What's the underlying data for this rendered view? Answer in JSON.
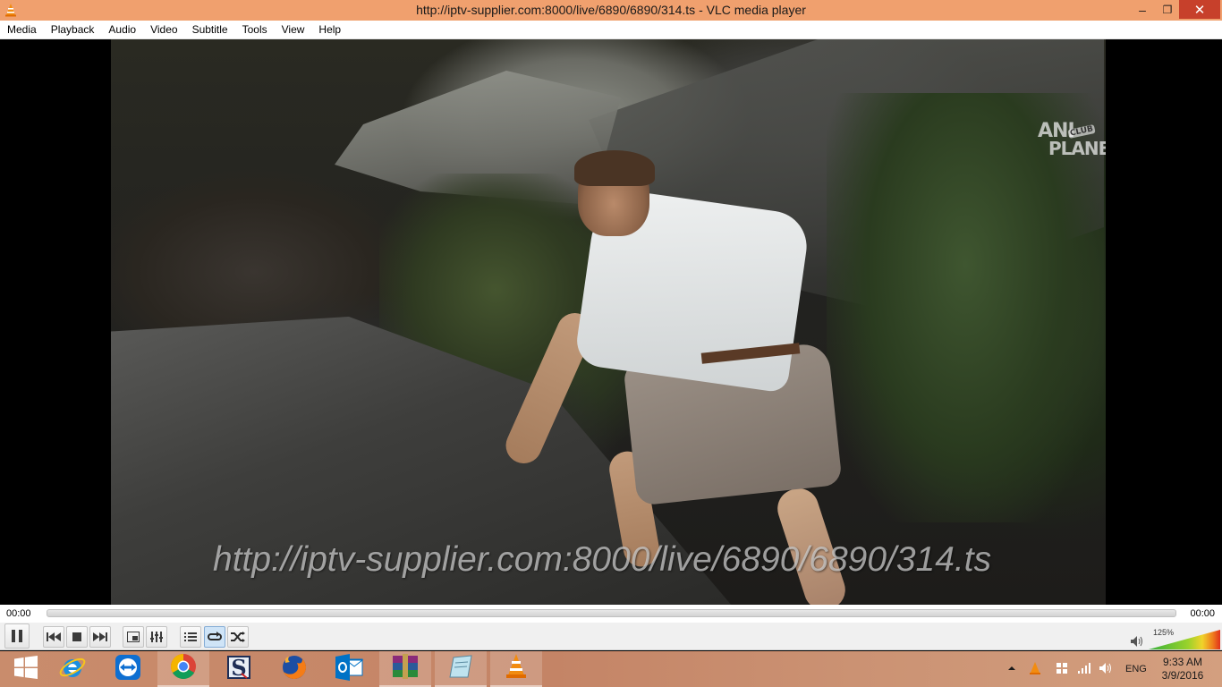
{
  "window": {
    "title": "http://iptv-supplier.com:8000/live/6890/6890/314.ts - VLC media player",
    "minimize": "–",
    "maximize": "❐",
    "close": "✕"
  },
  "menu": {
    "items": [
      "Media",
      "Playback",
      "Audio",
      "Video",
      "Subtitle",
      "Tools",
      "View",
      "Help"
    ]
  },
  "video": {
    "channel_logo_line1": "ANI",
    "channel_logo_club": "CLUB",
    "channel_logo_line2": "PLANET",
    "overlay_text": "http://iptv-supplier.com:8000/live/6890/6890/314.ts"
  },
  "seek": {
    "elapsed": "00:00",
    "total": "00:00",
    "position": 0
  },
  "controls": {
    "buttons": [
      {
        "name": "pause-button",
        "icon": "pause-icon"
      },
      {
        "name": "previous-button",
        "icon": "skip-previous-icon"
      },
      {
        "name": "stop-button",
        "icon": "stop-icon"
      },
      {
        "name": "next-button",
        "icon": "skip-next-icon"
      },
      {
        "name": "fullscreen-button",
        "icon": "fullscreen-icon"
      },
      {
        "name": "extended-settings-button",
        "icon": "equalizer-icon"
      },
      {
        "name": "playlist-button",
        "icon": "playlist-icon"
      },
      {
        "name": "loop-button",
        "icon": "loop-icon",
        "active": true
      },
      {
        "name": "shuffle-button",
        "icon": "shuffle-icon"
      }
    ],
    "volume_label": "125%",
    "volume_level": 1.25
  },
  "taskbar": {
    "apps": [
      "start-button",
      "internet-explorer",
      "teamviewer",
      "chrome",
      "sniper-app",
      "firefox",
      "outlook",
      "winrar",
      "notepad-app",
      "vlc"
    ],
    "tray_language": "ENG",
    "clock_time": "9:33 AM",
    "clock_date": "3/9/2016"
  },
  "colors": {
    "titlebar": "#f0a06e",
    "close_button": "#c7402b",
    "vlc_orange": "#f28c10",
    "taskbar": "#c98c6c"
  }
}
